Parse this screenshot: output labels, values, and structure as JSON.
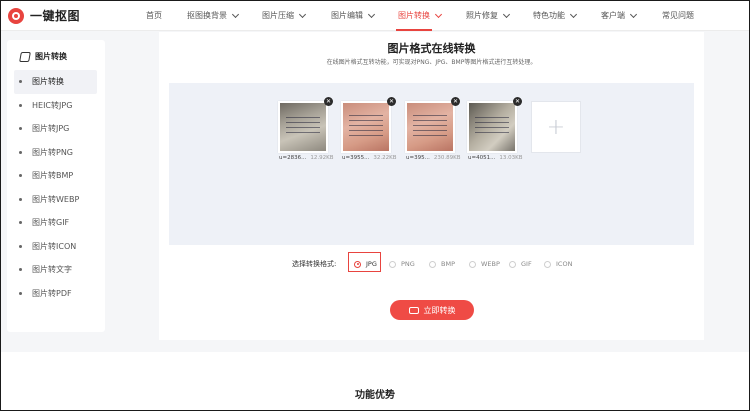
{
  "app": {
    "logo_text": "一键抠图"
  },
  "nav": {
    "items": [
      {
        "label": "首页",
        "dropdown": false
      },
      {
        "label": "抠图换背景",
        "dropdown": true
      },
      {
        "label": "图片压缩",
        "dropdown": true
      },
      {
        "label": "图片编辑",
        "dropdown": true
      },
      {
        "label": "图片转换",
        "dropdown": true,
        "active": true
      },
      {
        "label": "照片修复",
        "dropdown": true
      },
      {
        "label": "特色功能",
        "dropdown": true
      },
      {
        "label": "客户端",
        "dropdown": true
      },
      {
        "label": "常见问题",
        "dropdown": false
      }
    ]
  },
  "sidebar": {
    "title": "图片转换",
    "items": [
      {
        "label": "图片转换",
        "active": true
      },
      {
        "label": "HEIC转JPG"
      },
      {
        "label": "图片转JPG"
      },
      {
        "label": "图片转PNG"
      },
      {
        "label": "图片转BMP"
      },
      {
        "label": "图片转WEBP"
      },
      {
        "label": "图片转GIF"
      },
      {
        "label": "图片转ICON"
      },
      {
        "label": "图片转文字"
      },
      {
        "label": "图片转PDF"
      }
    ]
  },
  "main": {
    "title": "图片格式在线转换",
    "subtitle": "在线图片格式互转功能，可实现对PNG、JPG、BMP等图片格式进行互转处理。",
    "files": [
      {
        "name": "u=2836...",
        "size": "12.92KB",
        "style": "paper"
      },
      {
        "name": "u=3955...",
        "size": "32.22KB",
        "style": "pink"
      },
      {
        "name": "u=395...",
        "size": "230.89KB",
        "style": "pink"
      },
      {
        "name": "u=4051...",
        "size": "13.03KB",
        "style": "paper2"
      }
    ],
    "add_icon": "+",
    "close_icon": "✕",
    "format_label": "选择转换格式:",
    "formats": [
      "JPG",
      "PNG",
      "BMP",
      "WEBP",
      "GIF",
      "ICON"
    ],
    "selected_format": "JPG",
    "convert_button": "立即转换"
  },
  "bottom": {
    "title": "功能优势"
  },
  "colors": {
    "accent": "#e8443f",
    "panel_bg": "#eef1f7"
  }
}
